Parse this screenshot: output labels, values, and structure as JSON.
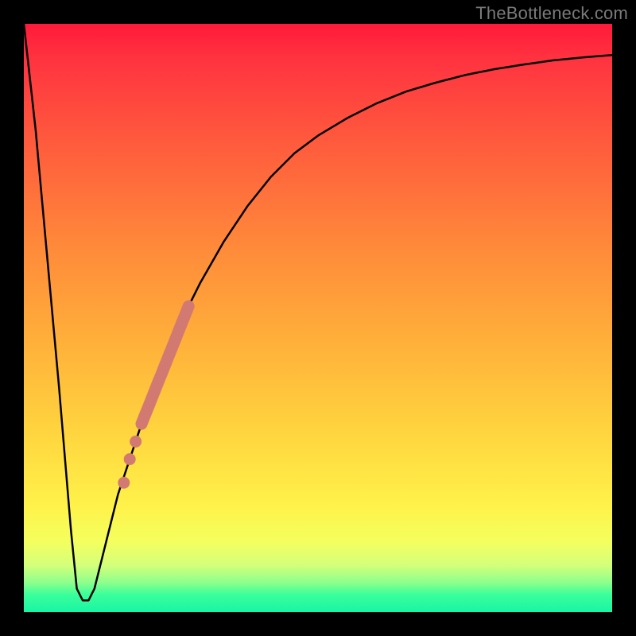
{
  "attribution": "TheBottleneck.com",
  "colors": {
    "frame": "#000000",
    "curve": "#000000",
    "marker": "#d27a71",
    "gradient_top": "#ff1a3a",
    "gradient_bottom": "#18f5a5"
  },
  "chart_data": {
    "type": "line",
    "title": "",
    "xlabel": "",
    "ylabel": "",
    "xlim": [
      0,
      100
    ],
    "ylim": [
      0,
      100
    ],
    "series": [
      {
        "name": "bottleneck-curve",
        "x": [
          0,
          2,
          4,
          6,
          8,
          9,
          10,
          11,
          12,
          14,
          16,
          18,
          20,
          22,
          24,
          26,
          28,
          30,
          34,
          38,
          42,
          46,
          50,
          55,
          60,
          65,
          70,
          75,
          80,
          85,
          90,
          95,
          100
        ],
        "values": [
          100,
          82,
          60,
          38,
          14,
          4,
          2,
          2,
          4,
          12,
          20,
          26,
          32,
          37,
          42,
          47,
          52,
          56,
          63,
          69,
          74,
          78,
          81,
          84,
          86.5,
          88.5,
          90,
          91.3,
          92.3,
          93.1,
          93.8,
          94.3,
          94.7
        ]
      },
      {
        "name": "highlight-band",
        "x": [
          20,
          28
        ],
        "values": [
          32,
          52
        ]
      },
      {
        "name": "highlight-dots",
        "x": [
          17,
          18,
          19
        ],
        "values": [
          22,
          26,
          29
        ]
      }
    ],
    "annotations": []
  }
}
